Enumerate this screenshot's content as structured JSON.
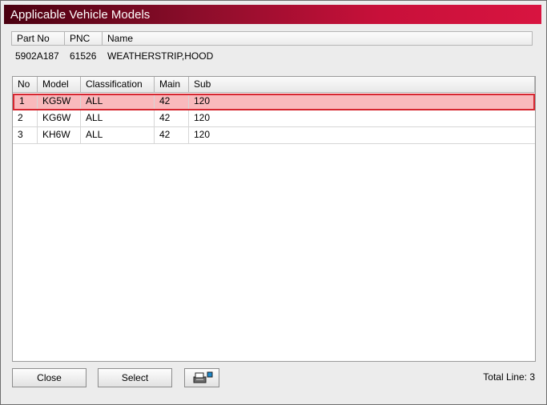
{
  "window": {
    "title": "Applicable Vehicle Models"
  },
  "part_header": {
    "columns": [
      "Part No",
      "PNC",
      "Name"
    ],
    "values": {
      "part_no": "5902A187",
      "pnc": "61526",
      "name": "WEATHERSTRIP,HOOD"
    }
  },
  "grid": {
    "columns": [
      "No",
      "Model",
      "Classification",
      "Main",
      "Sub"
    ],
    "rows": [
      {
        "no": "1",
        "model": "KG5W",
        "classification": "ALL",
        "main": "42",
        "sub": "120",
        "selected": true
      },
      {
        "no": "2",
        "model": "KG6W",
        "classification": "ALL",
        "main": "42",
        "sub": "120",
        "selected": false
      },
      {
        "no": "3",
        "model": "KH6W",
        "classification": "ALL",
        "main": "42",
        "sub": "120",
        "selected": false
      }
    ]
  },
  "footer": {
    "close_label": "Close",
    "select_label": "Select",
    "print_icon": "printer-icon",
    "total_text": "Total Line: 3"
  },
  "colors": {
    "title_gradient_start": "#4a0010",
    "title_gradient_end": "#d81440",
    "selected_row_bg": "#f9b9bc",
    "selected_row_border": "#d62630"
  }
}
